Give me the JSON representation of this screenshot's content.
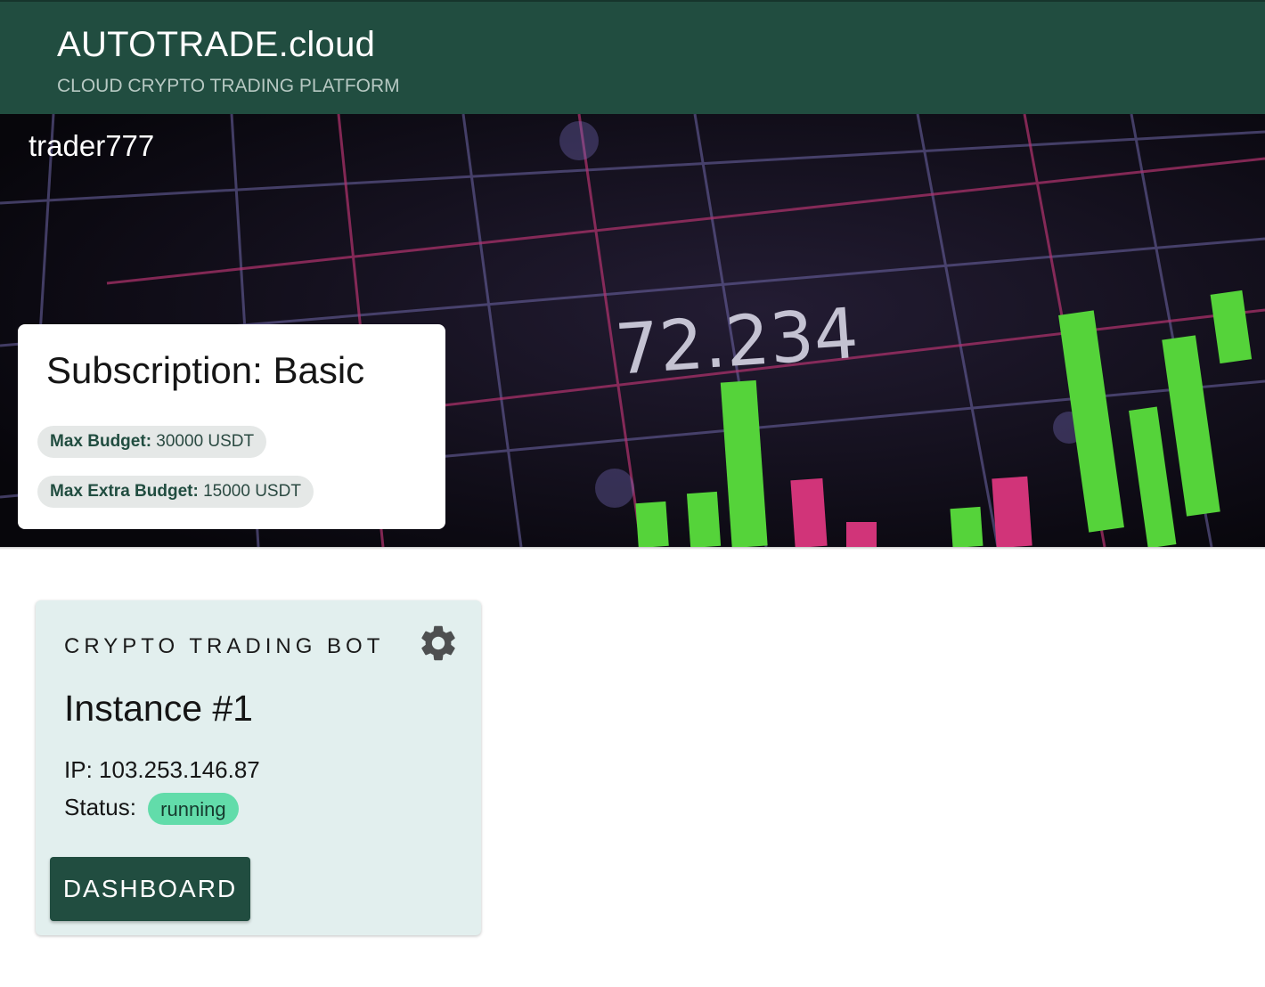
{
  "header": {
    "title": "AUTOTRADE.cloud",
    "subtitle": "CLOUD CRYPTO TRADING PLATFORM"
  },
  "hero": {
    "username": "trader777",
    "background_price_text": "72.234"
  },
  "subscription": {
    "title": "Subscription: Basic",
    "chips": [
      {
        "label": "Max Budget",
        "value": "30000 USDT"
      },
      {
        "label": "Max Extra Budget",
        "value": "15000 USDT"
      }
    ]
  },
  "bot": {
    "overline": "CRYPTO TRADING BOT",
    "settings_icon": "gear-icon",
    "instance_name": "Instance #1",
    "ip_label": "IP:",
    "ip_value": "103.253.146.87",
    "status_label": "Status:",
    "status_value": "running",
    "dashboard_label": "DASHBOARD"
  },
  "colors": {
    "primary": "#214d40",
    "card_background": "#e2efee",
    "status_running": "#62dcaa",
    "chip_background": "#e5e8e7"
  }
}
